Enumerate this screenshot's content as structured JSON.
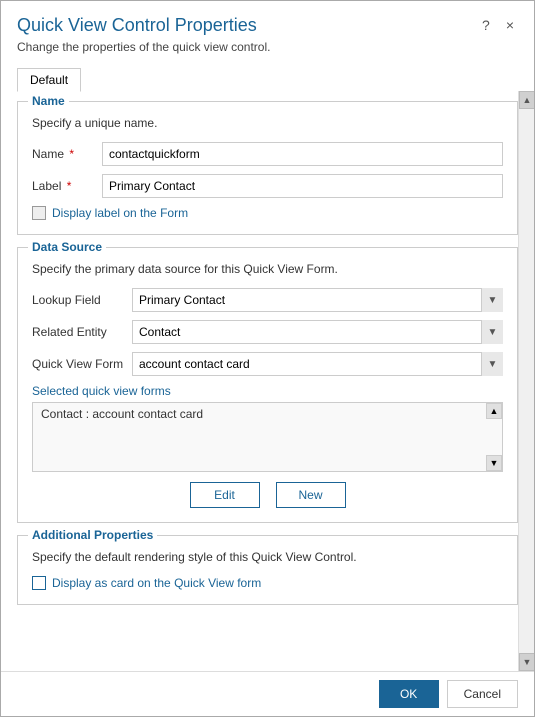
{
  "dialog": {
    "title": "Quick View Control Properties",
    "subtitle": "Change the properties of the quick view control.",
    "help_label": "?",
    "close_label": "×"
  },
  "tabs": [
    {
      "label": "Default",
      "active": true
    }
  ],
  "name_section": {
    "legend": "Name",
    "description": "Specify a unique name.",
    "fields": [
      {
        "label": "Name",
        "required": true,
        "value": "contactquickform",
        "name": "name-input"
      },
      {
        "label": "Label",
        "required": true,
        "value": "Primary Contact",
        "name": "label-input"
      }
    ],
    "checkbox": {
      "label": "Display label on the Form",
      "checked": false
    }
  },
  "datasource_section": {
    "legend": "Data Source",
    "description": "Specify the primary data source for this Quick View Form.",
    "fields": [
      {
        "label": "Lookup Field",
        "name": "lookup-field-select",
        "value": "Primary Contact",
        "options": [
          "Primary Contact"
        ]
      },
      {
        "label": "Related Entity",
        "name": "related-entity-select",
        "value": "Contact",
        "options": [
          "Contact"
        ]
      },
      {
        "label": "Quick View Form",
        "name": "quick-view-form-select",
        "value": "account contact card",
        "options": [
          "account contact card"
        ]
      }
    ],
    "selected_forms_label": "Selected quick view forms",
    "selected_forms_items": [
      "Contact : account contact card"
    ],
    "buttons": {
      "edit_label": "Edit",
      "new_label": "New"
    }
  },
  "additional_section": {
    "legend": "Additional Properties",
    "description": "Specify the default rendering style of this Quick View Control.",
    "checkbox": {
      "label": "Display as card on the Quick View form",
      "checked": false
    }
  },
  "footer": {
    "ok_label": "OK",
    "cancel_label": "Cancel"
  }
}
